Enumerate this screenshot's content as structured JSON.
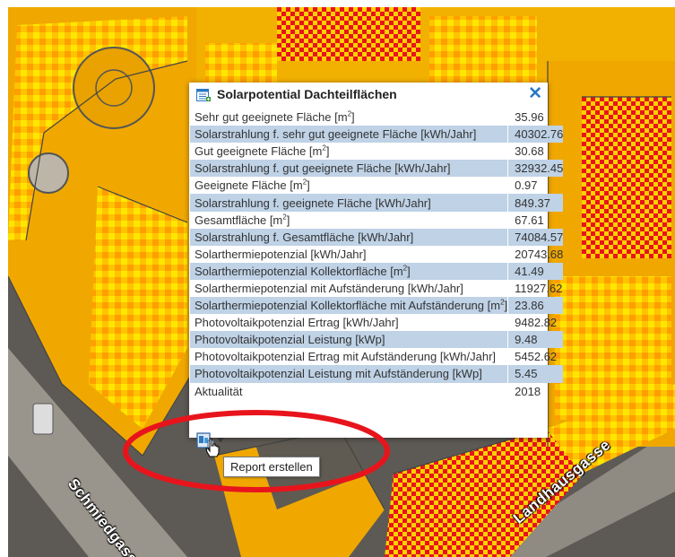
{
  "popup": {
    "title": "Solarpotential Dachteilflächen",
    "icon": "table-icon",
    "close": "✕",
    "rows": [
      {
        "label": "Sehr gut geeignete Fläche [m",
        "sup": "2",
        "suffix": "]",
        "value": "35.96"
      },
      {
        "label": "Solarstrahlung f. sehr gut geeignete Fläche [kWh/Jahr]",
        "sup": "",
        "suffix": "",
        "value": "40302.76"
      },
      {
        "label": "Gut geeignete Fläche [m",
        "sup": "2",
        "suffix": "]",
        "value": "30.68"
      },
      {
        "label": "Solarstrahlung f. gut geeignete Fläche [kWh/Jahr]",
        "sup": "",
        "suffix": "",
        "value": "32932.45"
      },
      {
        "label": "Geeignete Fläche [m",
        "sup": "2",
        "suffix": "]",
        "value": "0.97"
      },
      {
        "label": "Solarstrahlung f. geeignete Fläche [kWh/Jahr]",
        "sup": "",
        "suffix": "",
        "value": "849.37"
      },
      {
        "label": "Gesamtfläche [m",
        "sup": "2",
        "suffix": "]",
        "value": "67.61"
      },
      {
        "label": "Solarstrahlung f. Gesamtfläche [kWh/Jahr]",
        "sup": "",
        "suffix": "",
        "value": "74084.57"
      },
      {
        "label": "Solarthermiepotenzial [kWh/Jahr]",
        "sup": "",
        "suffix": "",
        "value": "20743.68"
      },
      {
        "label": "Solarthermiepotenzial Kollektorfläche [m",
        "sup": "2",
        "suffix": "]",
        "value": "41.49"
      },
      {
        "label": "Solarthermiepotenzial mit Aufständerung [kWh/Jahr]",
        "sup": "",
        "suffix": "",
        "value": "11927.62"
      },
      {
        "label": "Solarthermiepotenzial Kollektorfläche mit Aufständerung [m",
        "sup": "2",
        "suffix": "]",
        "value": "23.86"
      },
      {
        "label": "Photovoltaikpotenzial Ertrag [kWh/Jahr]",
        "sup": "",
        "suffix": "",
        "value": "9482.82"
      },
      {
        "label": "Photovoltaikpotenzial Leistung [kWp]",
        "sup": "",
        "suffix": "",
        "value": "9.48"
      },
      {
        "label": "Photovoltaikpotenzial Ertrag mit Aufständerung [kWh/Jahr]",
        "sup": "",
        "suffix": "",
        "value": "5452.62"
      },
      {
        "label": "Photovoltaikpotenzial Leistung mit Aufständerung [kWp]",
        "sup": "",
        "suffix": "",
        "value": "5.45"
      },
      {
        "label": "Aktualität",
        "sup": "",
        "suffix": "",
        "value": "2018"
      }
    ]
  },
  "report": {
    "icon": "report-icon",
    "tooltip": "Report erstellen"
  },
  "map": {
    "street_left": "Schmiedgasse",
    "street_right": "Landhausgasse",
    "colors": {
      "suitable": "#ffc400",
      "good": "#ffe800",
      "very_good": "#e8141c",
      "roof": "#f5aa00",
      "highlight": "#e8141c"
    }
  }
}
